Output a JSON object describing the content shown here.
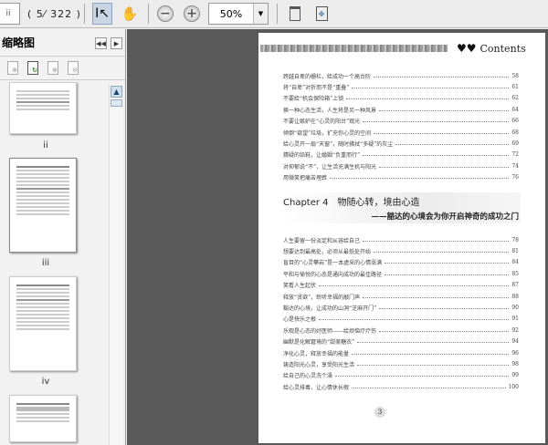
{
  "toolbar": {
    "page_input": "ii",
    "page_count": "( 5⁄ 322 )",
    "zoom": "50%"
  },
  "left_panel": {
    "title": "缩略图",
    "thumbnails": [
      {
        "label": "ii"
      },
      {
        "label": "iii"
      },
      {
        "label": "iv"
      },
      {
        "label": ""
      }
    ]
  },
  "page": {
    "header": "Contents",
    "toc1": [
      {
        "t": "跨越自卑的栅栏，给成功一个高台阶",
        "n": "58"
      },
      {
        "t": "将“自卑”对折而不是“重叠”",
        "n": "61"
      },
      {
        "t": "不要给“机会保险箱”上锁",
        "n": "62"
      },
      {
        "t": "换一种心态生活，人生将是另一种风景",
        "n": "64"
      },
      {
        "t": "不要让嫉妒在“心灵的阳台”观光",
        "n": "66"
      },
      {
        "t": "倾倒“欲望”垃圾，扩充你心灵的空间",
        "n": "68"
      },
      {
        "t": "给心灵开一扇“天窗”，随时拂拭“多疑”的灰尘",
        "n": "69"
      },
      {
        "t": "猜疑的铅鞋，让婚姻“负重而行”",
        "n": "72"
      },
      {
        "t": "对抑郁说“不”，让生活充满生机与阳光",
        "n": "74"
      },
      {
        "t": "用微笑把痛苦埋葬",
        "n": "76"
      }
    ],
    "chapter": {
      "num": "Chapter 4",
      "title": "物随心转，境由心造",
      "subtitle": "——豁达的心境会为你开启神奇的成功之门"
    },
    "toc2": [
      {
        "t": "人生要留一份淡定和从容给自己",
        "n": "78"
      },
      {
        "t": "想要达到最高处，必须从最低处开始",
        "n": "81"
      },
      {
        "t": "盲目的“心灵攀岩”是一本虚采的心情涨满",
        "n": "84"
      },
      {
        "t": "平和与愉悦的心态是通向成功的最佳路径",
        "n": "85"
      },
      {
        "t": "笑看人生起伏",
        "n": "87"
      },
      {
        "t": "释放“贪欲”，聆听幸福的敲门声",
        "n": "88"
      },
      {
        "t": "豁达的心境，让成功的山洞“芝麻开门”",
        "n": "90"
      },
      {
        "t": "心是快乐之根",
        "n": "91"
      },
      {
        "t": "乐观是心态的好医师——给烦恼疗疗伤",
        "n": "92"
      },
      {
        "t": "幽默是化解窘境的“甜美糖衣”",
        "n": "94"
      },
      {
        "t": "净化心灵，释放幸福的能量",
        "n": "96"
      },
      {
        "t": "铸造阳光心灵，享受阳光生活",
        "n": "98"
      },
      {
        "t": "给自己的心灵洗个澡",
        "n": "99"
      },
      {
        "t": "给心灵排毒，让心情休长假",
        "n": "100"
      }
    ],
    "page_number": "3"
  }
}
